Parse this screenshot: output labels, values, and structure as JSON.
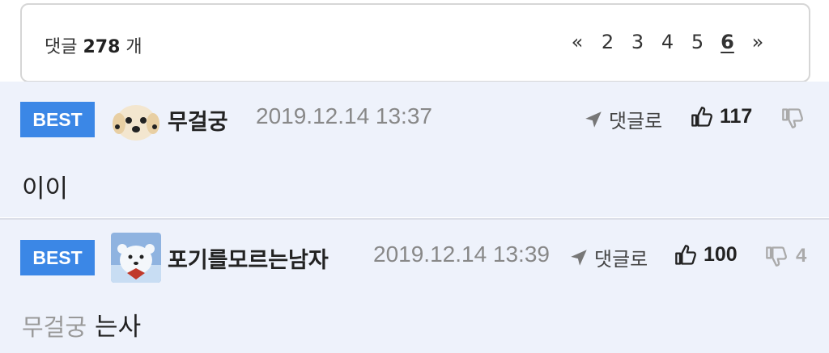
{
  "header": {
    "label": "댓글",
    "count": "278",
    "unit": "개"
  },
  "pagination": {
    "prev": "«",
    "pages": [
      "2",
      "3",
      "4",
      "5",
      "6"
    ],
    "current": "6",
    "next": "»"
  },
  "comments": [
    {
      "badge": "BEST",
      "nickname": "무걸궁",
      "datetime": "2019.12.14 13:37",
      "reply_label": "댓글로",
      "likes": "117",
      "dislikes": "",
      "body": "이이",
      "quoted_nick": ""
    },
    {
      "badge": "BEST",
      "nickname": "포기를모르는남자",
      "datetime": "2019.12.14 13:39",
      "reply_label": "댓글로",
      "likes": "100",
      "dislikes": "4",
      "body": "는사",
      "quoted_nick": "무걸궁"
    }
  ],
  "colors": {
    "best_badge": "#3b87e6",
    "comment_bg": "#eef2fb"
  }
}
